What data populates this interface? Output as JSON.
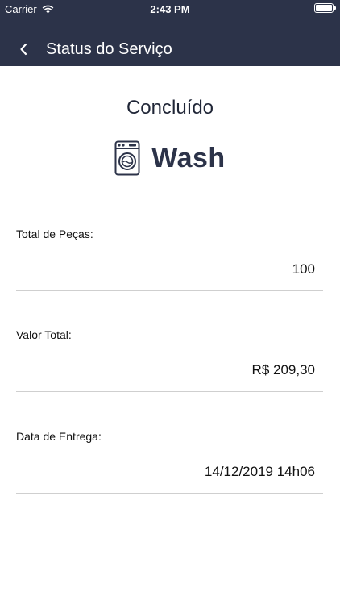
{
  "status_bar": {
    "carrier": "Carrier",
    "time": "2:43 PM"
  },
  "nav": {
    "title": "Status do Serviço",
    "back_icon": "chevron-left-icon"
  },
  "status": {
    "label": "Concluído"
  },
  "logo": {
    "text": "Wash",
    "icon": "washing-machine-icon"
  },
  "fields": [
    {
      "label": "Total de Peças:",
      "value": "100"
    },
    {
      "label": "Valor Total:",
      "value": "R$ 209,30"
    },
    {
      "label": "Data de Entrega:",
      "value": "14/12/2019 14h06"
    }
  ],
  "colors": {
    "header": "#2c3349",
    "divider": "#cfcfcf"
  }
}
